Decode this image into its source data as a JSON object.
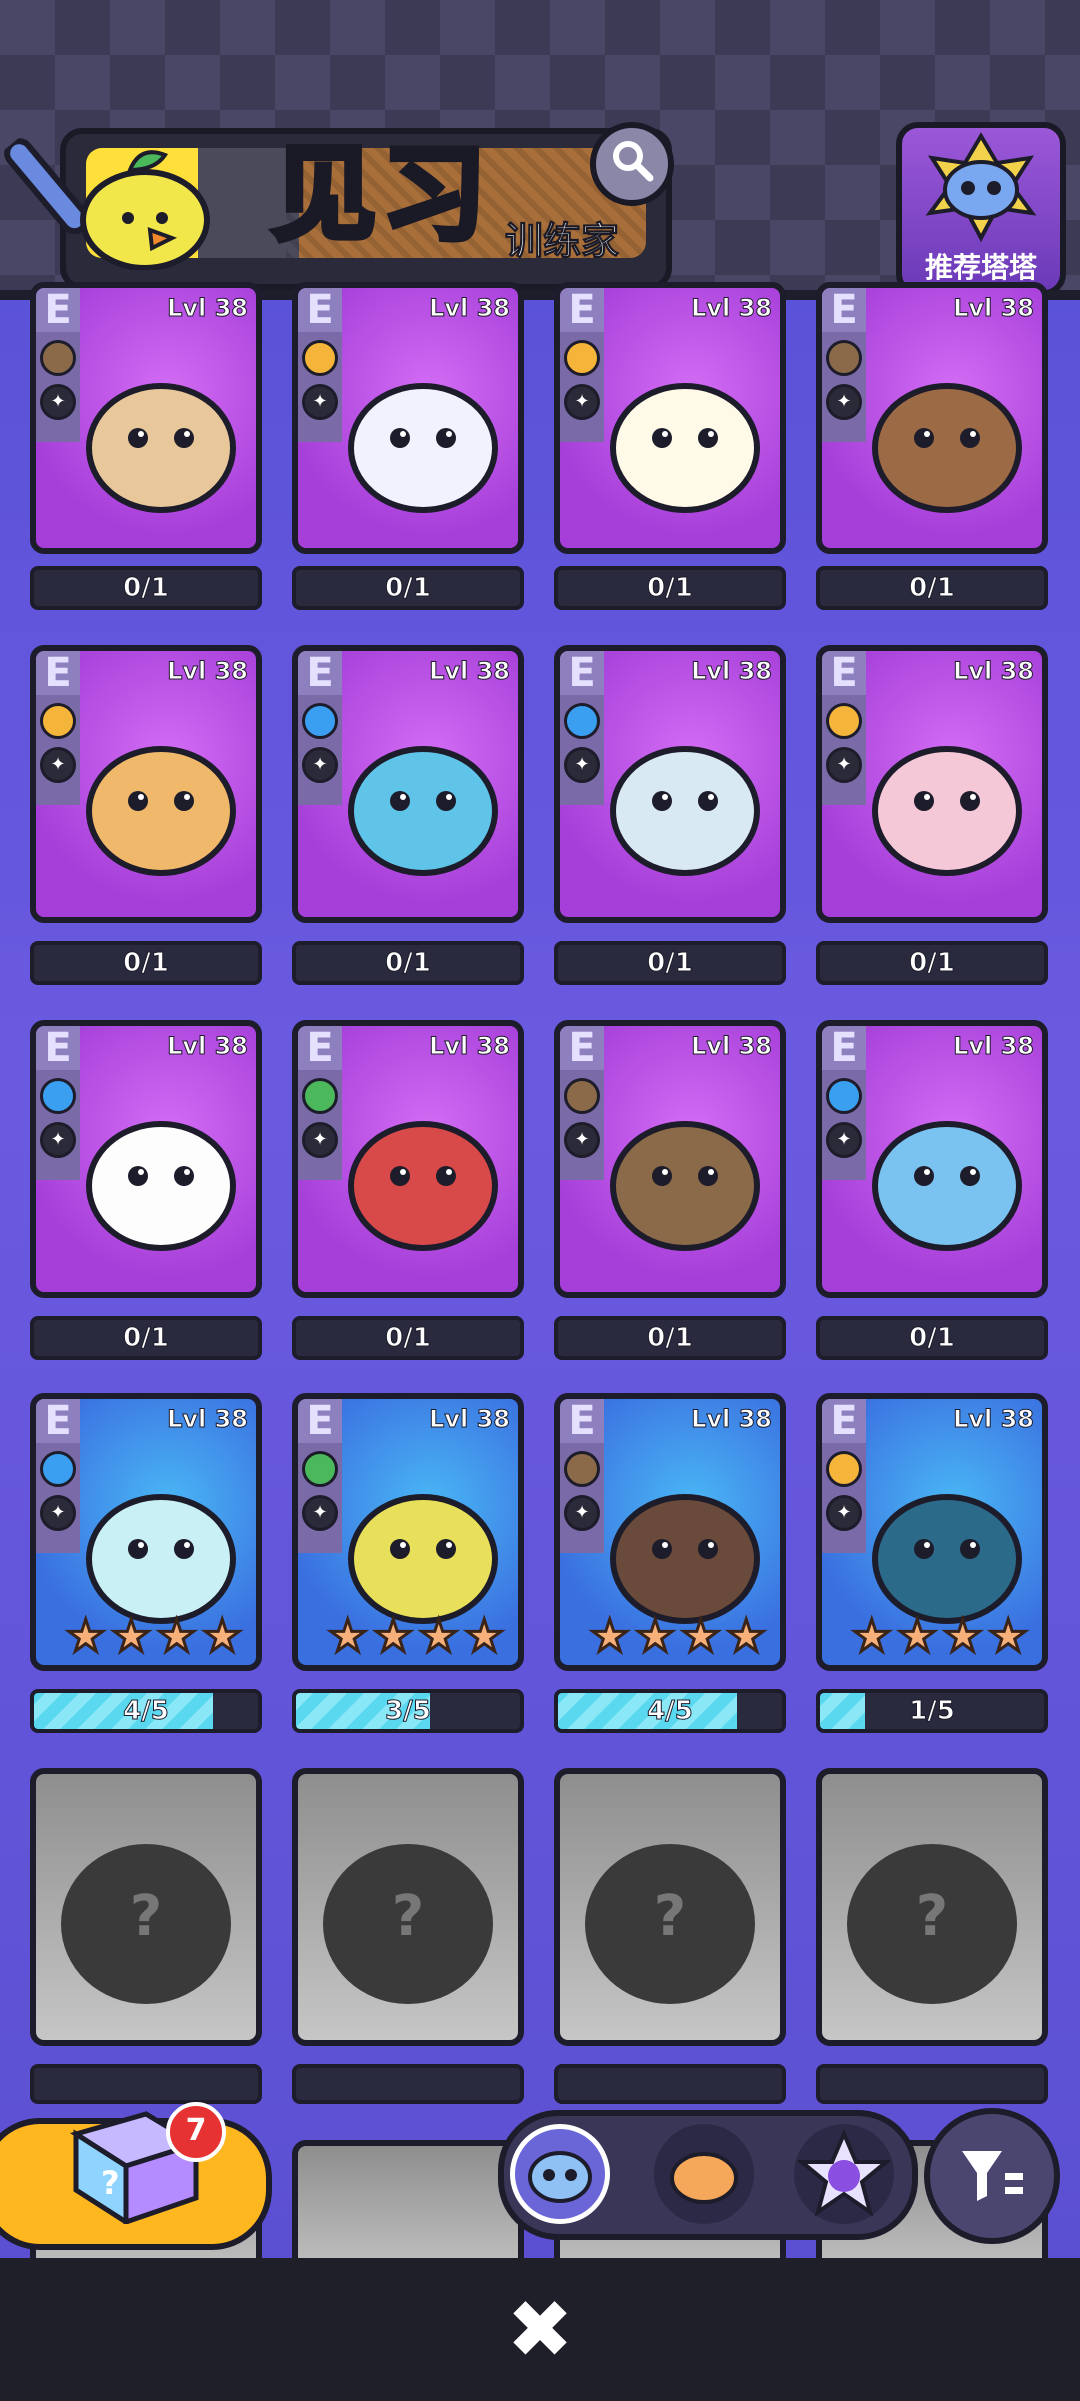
{
  "header": {
    "title": "见习",
    "subtitle": "训练家",
    "search_icon": "search-icon",
    "recommend_label": "推荐塔塔"
  },
  "rows": [
    {
      "kind": "purple",
      "cards": [
        {
          "tier": "E",
          "level": "Lvl 38",
          "progress": "0/1",
          "e1": "#8a6a48",
          "e2": "boot"
        },
        {
          "tier": "E",
          "level": "Lvl 38",
          "progress": "0/1",
          "e1": "#f5b43a",
          "e2": "flask"
        },
        {
          "tier": "E",
          "level": "Lvl 38",
          "progress": "0/1",
          "e1": "#f5b43a",
          "e2": "boot"
        },
        {
          "tier": "E",
          "level": "Lvl 38",
          "progress": "0/1",
          "e1": "#8a6a48",
          "e2": "boot"
        }
      ]
    },
    {
      "kind": "purple",
      "cards": [
        {
          "tier": "E",
          "level": "Lvl 38",
          "progress": "0/1",
          "e1": "#f5b43a",
          "e2": "head"
        },
        {
          "tier": "E",
          "level": "Lvl 38",
          "progress": "0/1",
          "e1": "#3a9ff0",
          "e2": "boot"
        },
        {
          "tier": "E",
          "level": "Lvl 38",
          "progress": "0/1",
          "e1": "#3a9ff0",
          "e2": "flask"
        },
        {
          "tier": "E",
          "level": "Lvl 38",
          "progress": "0/1",
          "e1": "#f5b43a",
          "e2": "plus"
        }
      ]
    },
    {
      "kind": "purple",
      "cards": [
        {
          "tier": "E",
          "level": "Lvl 38",
          "progress": "0/1",
          "e1": "#3a9ff0",
          "e2": "shield"
        },
        {
          "tier": "E",
          "level": "Lvl 38",
          "progress": "0/1",
          "e1": "#4cb85c",
          "e2": "boot"
        },
        {
          "tier": "E",
          "level": "Lvl 38",
          "progress": "0/1",
          "e1": "#8a6a48",
          "e2": "flask"
        },
        {
          "tier": "E",
          "level": "Lvl 38",
          "progress": "0/1",
          "e1": "#3a9ff0",
          "e2": "flask"
        }
      ]
    },
    {
      "kind": "blue",
      "cards": [
        {
          "tier": "E",
          "level": "Lvl 38",
          "progress": "4/5",
          "fill": 0.8,
          "e1": "#3a9ff0",
          "e2": "head"
        },
        {
          "tier": "E",
          "level": "Lvl 38",
          "progress": "3/5",
          "fill": 0.6,
          "e1": "#4cb85c",
          "e2": "head"
        },
        {
          "tier": "E",
          "level": "Lvl 38",
          "progress": "4/5",
          "fill": 0.8,
          "e1": "#8a6a48",
          "e2": "boot"
        },
        {
          "tier": "E",
          "level": "Lvl 38",
          "progress": "1/5",
          "fill": 0.2,
          "e1": "#f5b43a",
          "e2": "boot"
        }
      ]
    }
  ],
  "locked": {
    "mark": "?"
  },
  "bottom": {
    "lucky_box_count": "7",
    "close_icon": "✖",
    "filter_icon": "filter-icon"
  }
}
